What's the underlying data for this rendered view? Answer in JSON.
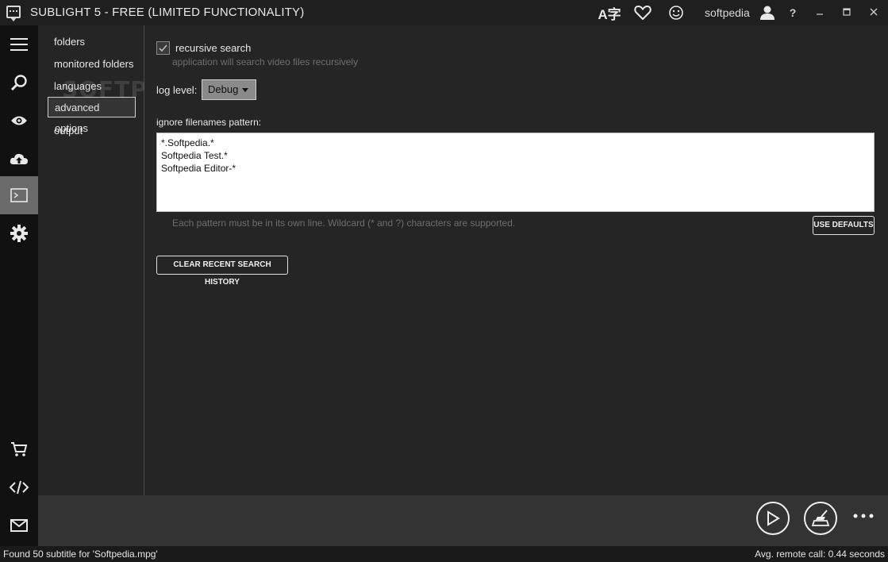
{
  "titlebar": {
    "title": "SUBLIGHT 5 - FREE (LIMITED FUNCTIONALITY)",
    "user": "softpedia",
    "help": "?",
    "translate_glyph": "A字"
  },
  "icons": {
    "app": "app-logo-icon",
    "translate": "translate-icon",
    "favorite": "heart-icon",
    "feedback": "smiley-icon",
    "user": "user-icon"
  },
  "leftbar": {
    "items": [
      "menu-icon",
      "search-icon",
      "eye-icon",
      "upload-cloud-icon",
      "console-icon",
      "gear-icon",
      "cart-icon",
      "code-icon",
      "mail-icon"
    ]
  },
  "subnav": {
    "items": [
      {
        "label": "folders"
      },
      {
        "label": "monitored folders"
      },
      {
        "label": "languages"
      },
      {
        "label": "advanced options"
      },
      {
        "label": "output"
      }
    ]
  },
  "settings": {
    "recursive_label": "recursive search",
    "recursive_hint": "application will search video files recursively",
    "recursive_checked": true,
    "log_level_label": "log level:",
    "log_level_value": "Debug",
    "ignore_label": "ignore filenames pattern:",
    "ignore_patterns": [
      "*.Softpedia.*",
      "Softpedia Test.*",
      "Softpedia Editor-*"
    ],
    "pattern_hint": "Each pattern must be in its own line. Wildcard (* and ?) characters are supported.",
    "use_defaults": "USE DEFAULTS",
    "clear_history": "CLEAR RECENT SEARCH HISTORY"
  },
  "watermark": "SOFTPEDIA",
  "status": {
    "left": "Found 50 subtitle for 'Softpedia.mpg'",
    "right": "Avg. remote call: 0.44 seconds"
  },
  "colors": {
    "background": "#252525",
    "sidebar": "#111111",
    "active_item": "#6b6b6b",
    "accent": "#e8e8e8"
  }
}
